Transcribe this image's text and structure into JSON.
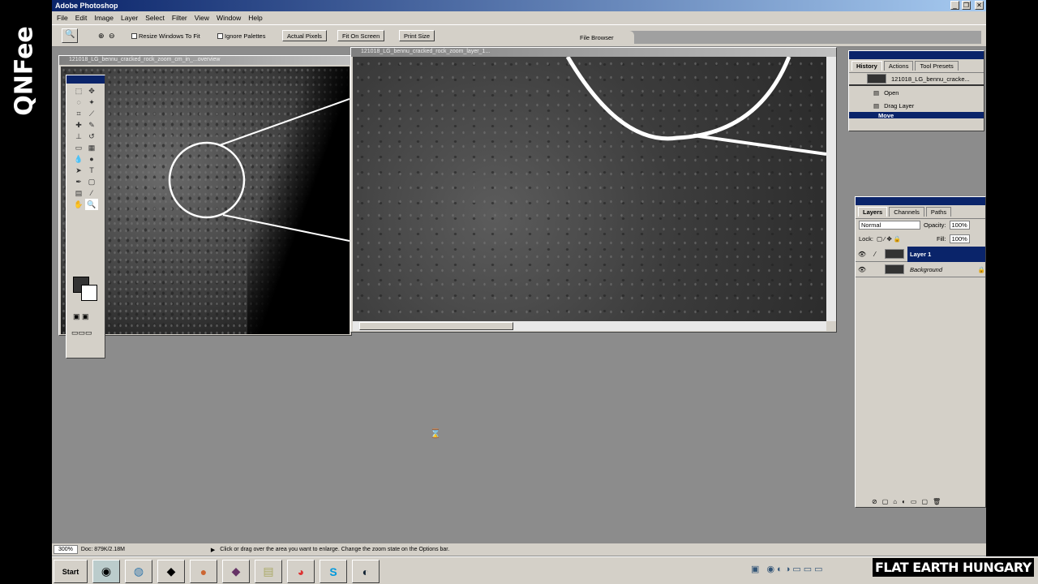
{
  "watermarks": {
    "left": "QNFee",
    "bottom_right": "FLAT EARTH HUNGARY"
  },
  "app": {
    "title": "Adobe Photoshop",
    "window_buttons": [
      "_",
      "❐",
      "✕"
    ]
  },
  "menu": [
    "File",
    "Edit",
    "Image",
    "Layer",
    "Select",
    "Filter",
    "View",
    "Window",
    "Help"
  ],
  "options": {
    "resize_windows": "Resize Windows To Fit",
    "ignore_palettes": "Ignore Palettes",
    "actual_pixels": "Actual Pixels",
    "fit_on_screen": "Fit On Screen",
    "print_size": "Print Size",
    "file_browser": "File Browser"
  },
  "docs": [
    {
      "title": "121018_LG_bennu_cracked_rock_zoom_cm_in_...overview"
    },
    {
      "title": "121018_LG_bennu_cracked_rock_zoom_layer_1..."
    }
  ],
  "history": {
    "tabs": [
      "History",
      "Actions",
      "Tool Presets"
    ],
    "snapshot": "121018_LG_bennu_cracke...",
    "items": [
      "Open",
      "Drag Layer",
      "Move"
    ]
  },
  "layers": {
    "tabs": [
      "Layers",
      "Channels",
      "Paths"
    ],
    "blend": "Normal",
    "opacity_label": "Opacity:",
    "opacity": "100%",
    "lock_label": "Lock:",
    "fill_label": "Fill:",
    "fill": "100%",
    "items": [
      {
        "name": "Layer 1",
        "selected": true
      },
      {
        "name": "Background",
        "selected": false
      }
    ]
  },
  "status": {
    "zoom": "300%",
    "doc": "Doc: 879K/2.18M",
    "hint": "Click or drag over the area you want to enlarge. Change the zoom state on the Options bar."
  },
  "taskbar": {
    "start": "Start",
    "apps": [
      "photoshop-icon",
      "browser-icon",
      "app-icon",
      "game-icon",
      "app2-icon",
      "folder-icon",
      "chrome-icon",
      "skype-icon",
      "steam-icon"
    ]
  }
}
